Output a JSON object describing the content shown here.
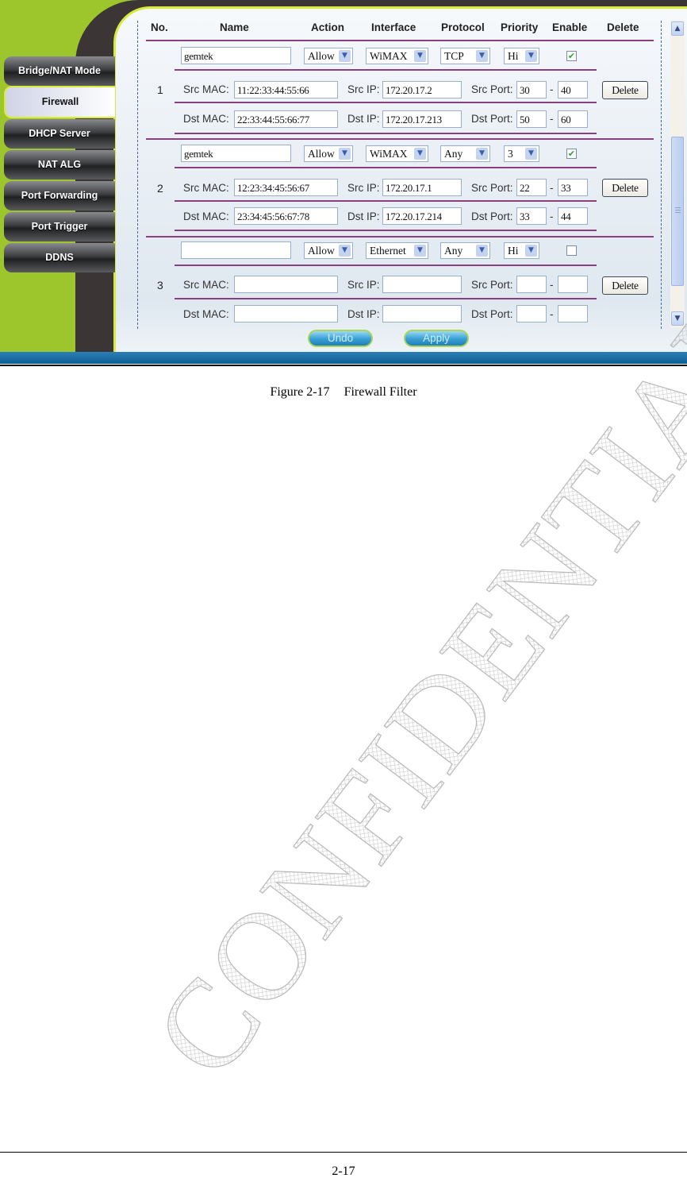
{
  "sidebar": {
    "items": [
      {
        "label": "Bridge/NAT Mode",
        "active": false
      },
      {
        "label": "Firewall",
        "active": true
      },
      {
        "label": "DHCP Server",
        "active": false
      },
      {
        "label": "NAT ALG",
        "active": false
      },
      {
        "label": "Port Forwarding",
        "active": false
      },
      {
        "label": "Port Trigger",
        "active": false
      },
      {
        "label": "DDNS",
        "active": false
      }
    ]
  },
  "table": {
    "headers": [
      "No.",
      "Name",
      "Action",
      "Interface",
      "Protocol",
      "Priority",
      "Enable",
      "Delete"
    ],
    "labels": {
      "src_mac": "Src MAC:",
      "dst_mac": "Dst MAC:",
      "src_ip": "Src IP:",
      "dst_ip": "Dst IP:",
      "src_port": "Src Port:",
      "dst_port": "Dst Port:",
      "range_sep": "-",
      "delete_button": "Delete"
    },
    "rules": [
      {
        "no": "1",
        "name": "gemtek",
        "action": "Allow",
        "interface": "WiMAX",
        "protocol": "TCP",
        "priority": "Hi",
        "enabled": true,
        "src_mac": "11:22:33:44:55:66",
        "src_ip": "172.20.17.2",
        "src_port_from": "30",
        "src_port_to": "40",
        "dst_mac": "22:33:44:55:66:77",
        "dst_ip": "172.20.17.213",
        "dst_port_from": "50",
        "dst_port_to": "60"
      },
      {
        "no": "2",
        "name": "gemtek",
        "action": "Allow",
        "interface": "WiMAX",
        "protocol": "Any",
        "priority": "3",
        "enabled": true,
        "src_mac": "12:23:34:45:56:67",
        "src_ip": "172.20.17.1",
        "src_port_from": "22",
        "src_port_to": "33",
        "dst_mac": "23:34:45:56:67:78",
        "dst_ip": "172.20.17.214",
        "dst_port_from": "33",
        "dst_port_to": "44"
      },
      {
        "no": "3",
        "name": "",
        "action": "Allow",
        "interface": "Ethernet",
        "protocol": "Any",
        "priority": "Hi",
        "enabled": false,
        "src_mac": "",
        "src_ip": "",
        "src_port_from": "",
        "src_port_to": "",
        "dst_mac": "",
        "dst_ip": "",
        "dst_port_from": "",
        "dst_port_to": ""
      }
    ]
  },
  "buttons": {
    "undo": "Undo",
    "apply": "Apply"
  },
  "icons": {
    "dropdown": "chevron-down-icon",
    "checkbox_checked": "check-icon",
    "scroll_up": "chevron-up-icon",
    "scroll_down": "chevron-down-icon"
  },
  "document": {
    "caption_label": "Figure 2-17",
    "caption_title": "Firewall Filter",
    "page_number": "2-17",
    "watermark": "CONFIDENTIAL"
  },
  "colors": {
    "brand_green": "#9dc62d",
    "row_separator": "#8a3f7e",
    "footer_blue": "#0f5d92"
  }
}
